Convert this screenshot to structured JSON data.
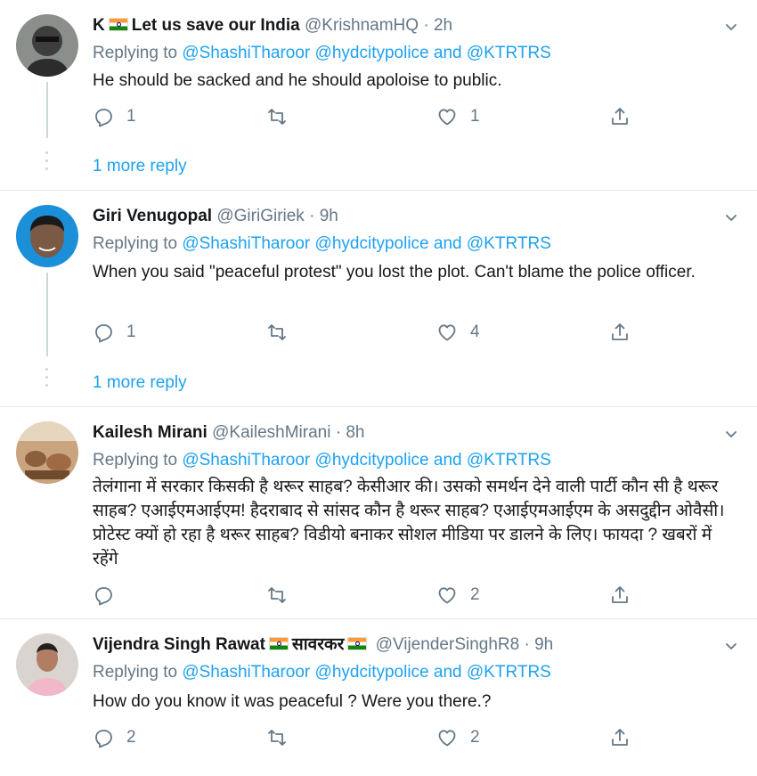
{
  "replying_label": "Replying to",
  "and_label": "and",
  "tweets": [
    {
      "name": "K",
      "name_suffix": "Let us save our India",
      "handle": "@KrishnamHQ",
      "time": "· 2h",
      "mentions": [
        "@ShashiTharoor",
        "@hydcitypolice",
        "@KTRTRS"
      ],
      "text": "He should be sacked and he should apoloise to public.",
      "replies": "1",
      "retweets": "",
      "likes": "1",
      "more_reply": "1 more reply"
    },
    {
      "name": "Giri Venugopal",
      "handle": "@GiriGiriek",
      "time": "· 9h",
      "mentions": [
        "@ShashiTharoor",
        "@hydcitypolice",
        "@KTRTRS"
      ],
      "text": "When you said \"peaceful protest\" you lost the plot. Can't blame the police officer.",
      "replies": "1",
      "retweets": "",
      "likes": "4",
      "more_reply": "1 more reply"
    },
    {
      "name": "Kailesh Mirani",
      "handle": "@KaileshMirani",
      "time": "· 8h",
      "mentions": [
        "@ShashiTharoor",
        "@hydcitypolice",
        "@KTRTRS"
      ],
      "text": "तेलंगाना में सरकार किसकी है थरूर साहब? केसीआर की। उसको समर्थन देने वाली पार्टी कौन सी है थरूर साहब? एआईएमआईएम! हैदराबाद से सांसद कौन है थरूर साहब? एआईएमआईएम के असदुद्दीन ओवैसी। प्रोटेस्ट क्यों हो रहा है थरूर साहब? विडीयो बनाकर सोशल मीडिया पर डालने के लिए। फायदा ? खबरों में रहेंगे",
      "replies": "",
      "retweets": "",
      "likes": "2"
    },
    {
      "name": "Vijendra Singh Rawat",
      "name_suffix": "सावरकर",
      "handle": "@VijenderSinghR8",
      "time": "· 9h",
      "mentions": [
        "@ShashiTharoor",
        "@hydcitypolice",
        "@KTRTRS"
      ],
      "text": "How do you know it was peaceful ?  Were you there.?",
      "replies": "2",
      "retweets": "",
      "likes": "2"
    }
  ]
}
